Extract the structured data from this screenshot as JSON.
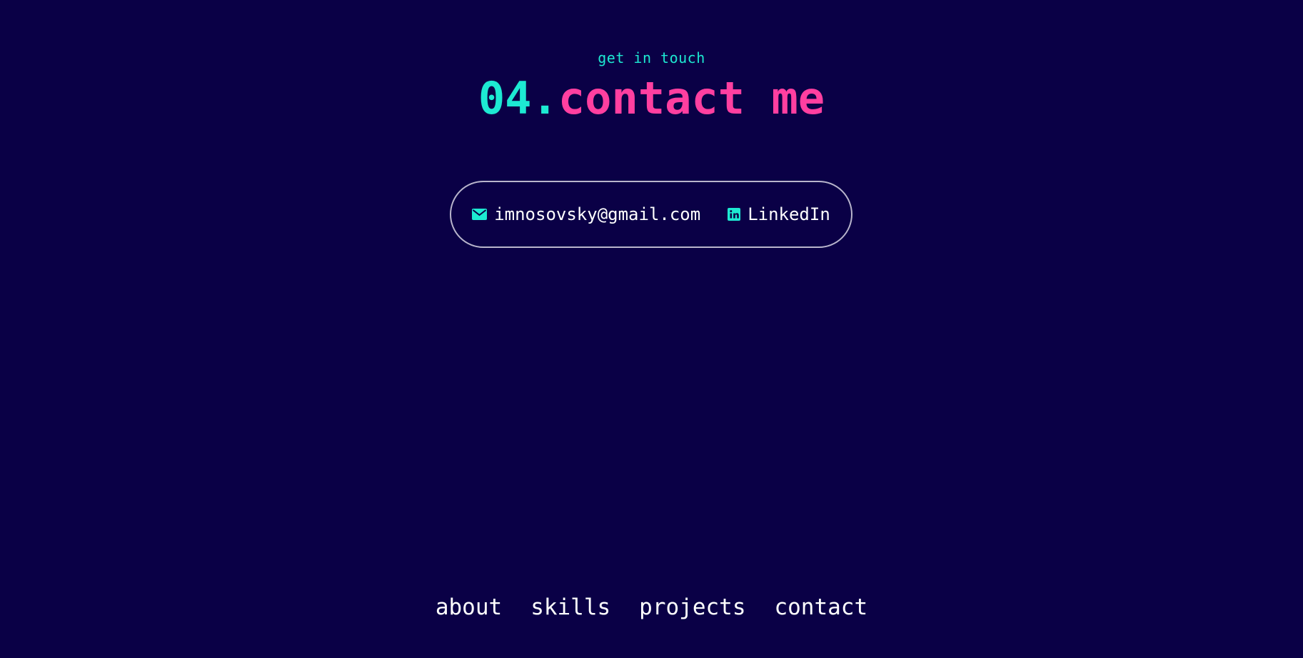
{
  "colors": {
    "background": "#0a0046",
    "accent_teal": "#1de9d2",
    "accent_pink": "#ff3fa0",
    "text": "#ffffff",
    "pill_border": "#b9b5cc"
  },
  "section": {
    "eyebrow": "get in touch",
    "number": "04.",
    "title": "contact me"
  },
  "contacts": {
    "email": {
      "icon": "envelope-icon",
      "label": "imnosovsky@gmail.com"
    },
    "linkedin": {
      "icon": "linkedin-icon",
      "label": "LinkedIn"
    }
  },
  "footer": {
    "nav": [
      {
        "label": "about"
      },
      {
        "label": "skills"
      },
      {
        "label": "projects"
      },
      {
        "label": "contact"
      }
    ]
  }
}
